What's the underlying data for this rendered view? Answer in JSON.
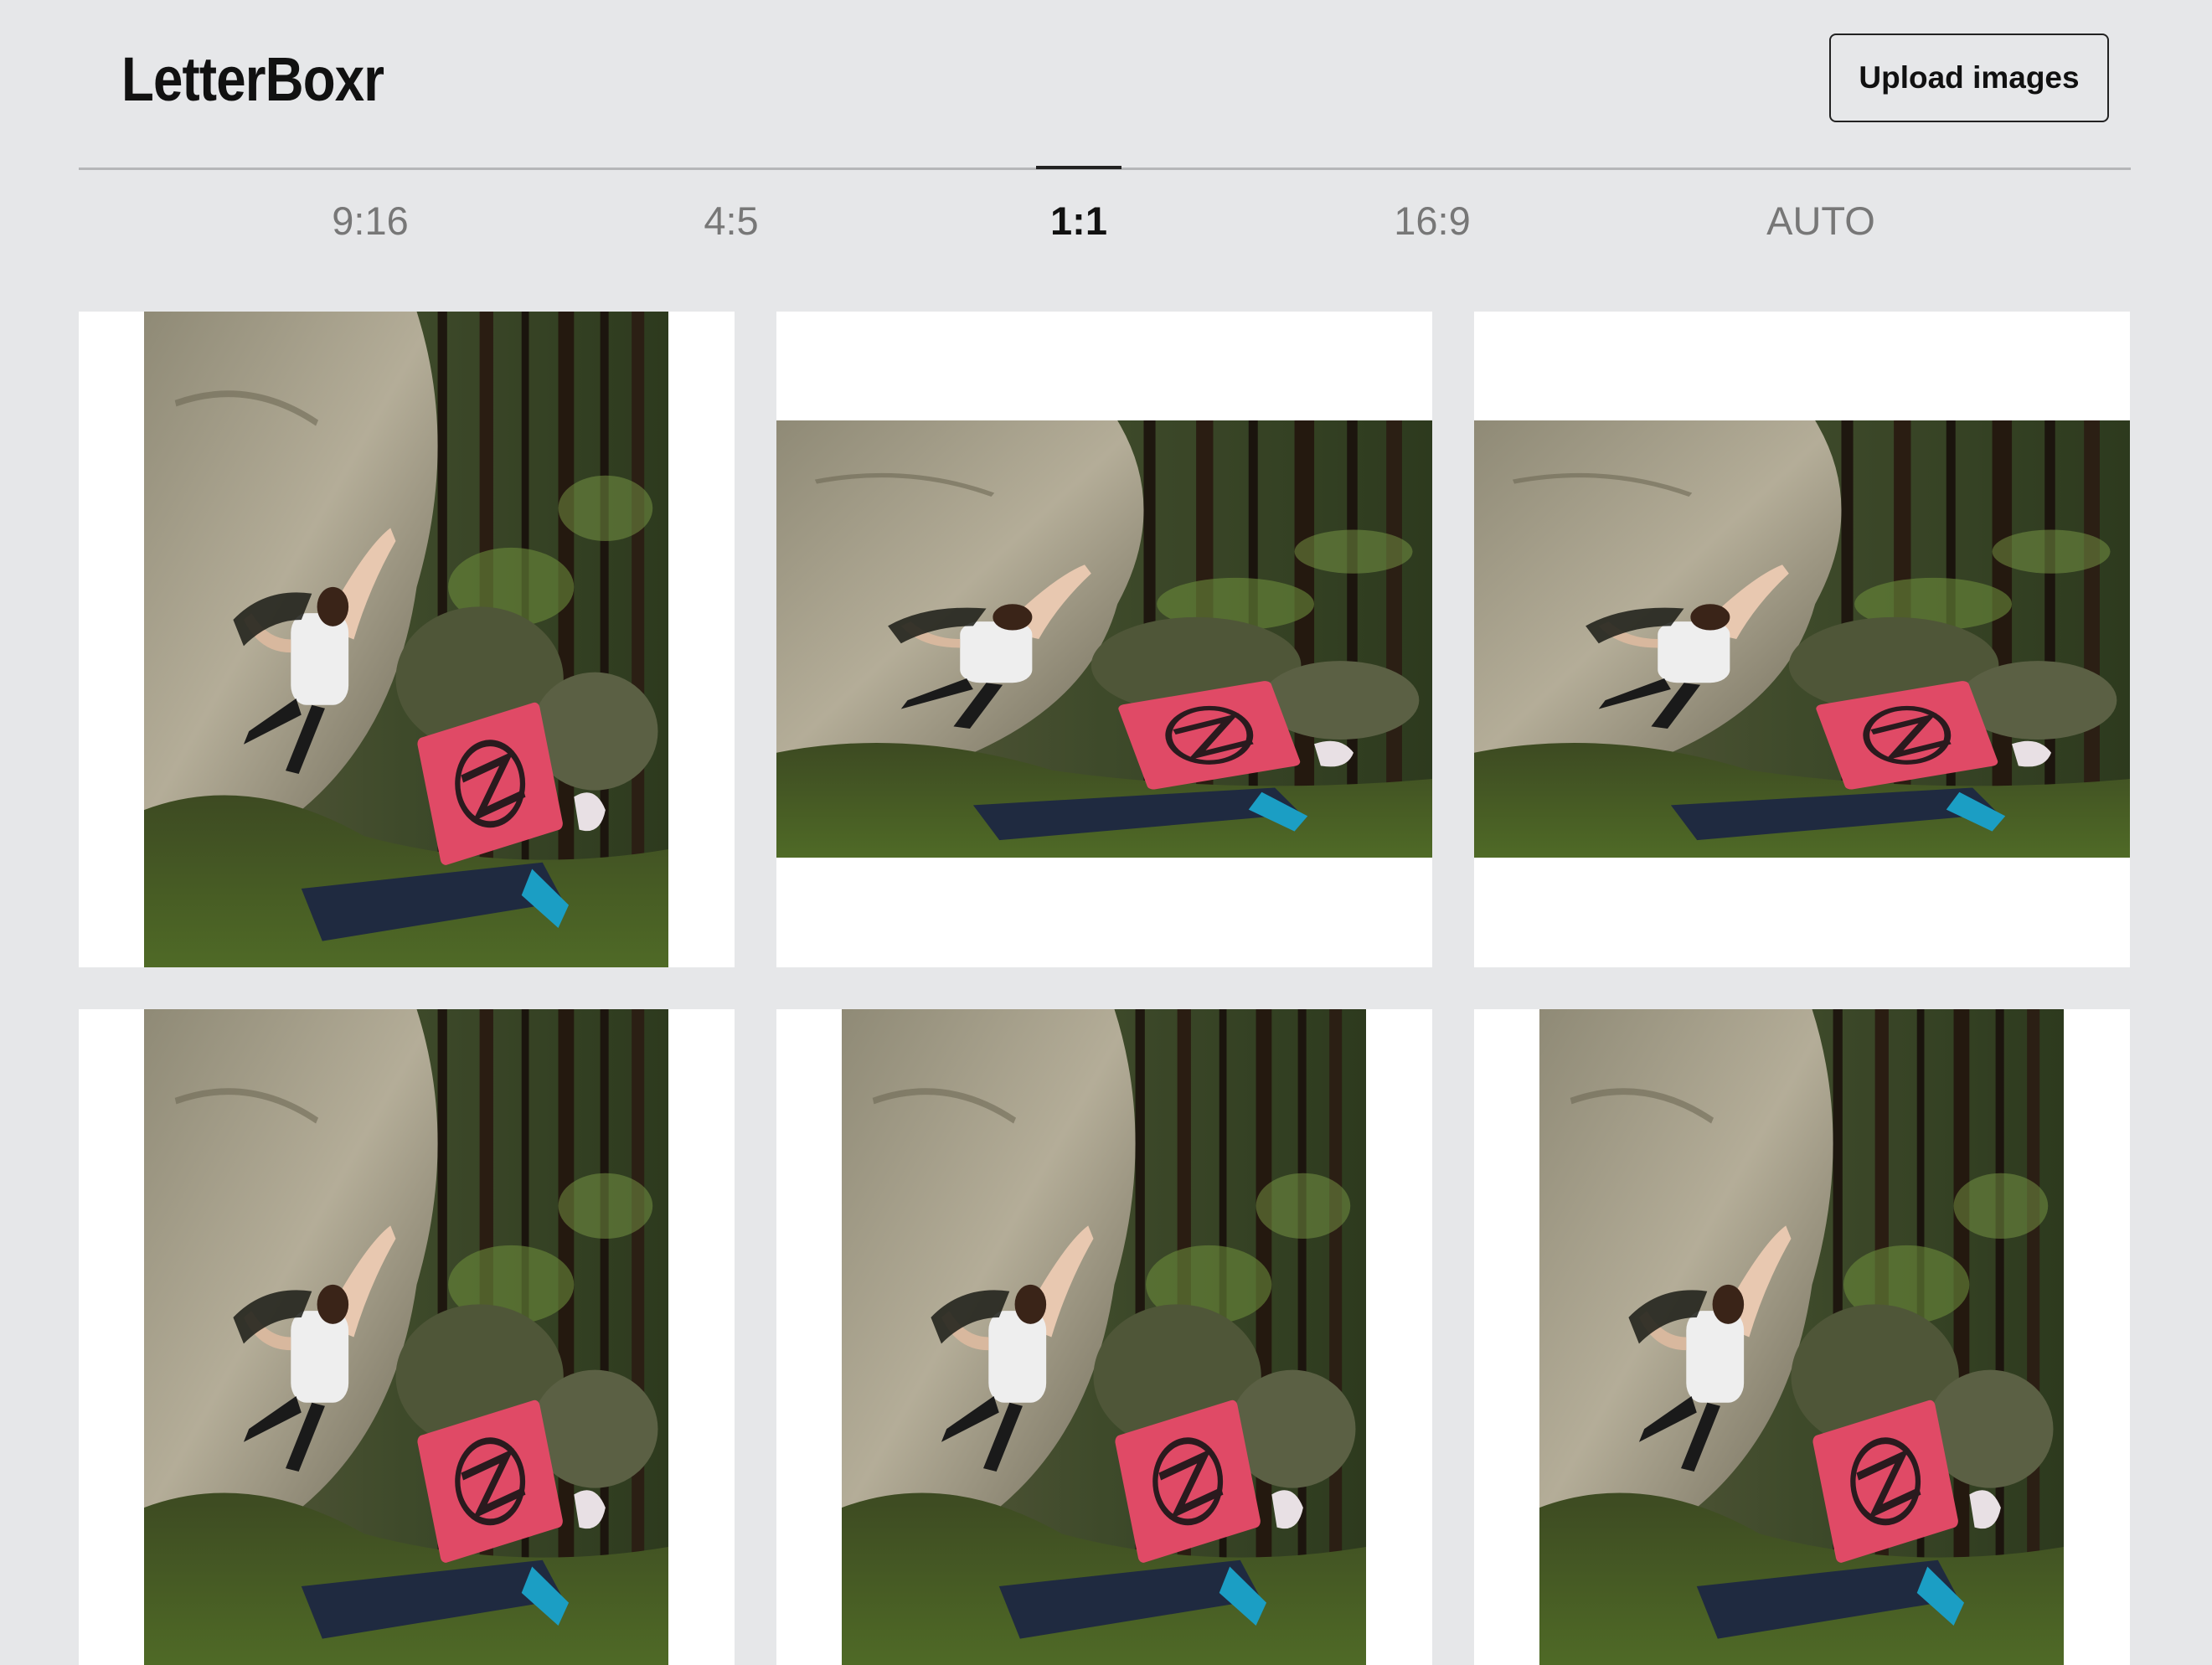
{
  "app": {
    "title": "LetterBoxr"
  },
  "toolbar": {
    "upload_label": "Upload images"
  },
  "tabs": [
    {
      "label": "9:16",
      "active": false
    },
    {
      "label": "4:5",
      "active": false
    },
    {
      "label": "1:1",
      "active": true
    },
    {
      "label": "16:9",
      "active": false
    },
    {
      "label": "AUTO",
      "active": false
    }
  ],
  "colors": {
    "background": "#e6e7e9",
    "card": "#ffffff",
    "accent": "#222222"
  }
}
